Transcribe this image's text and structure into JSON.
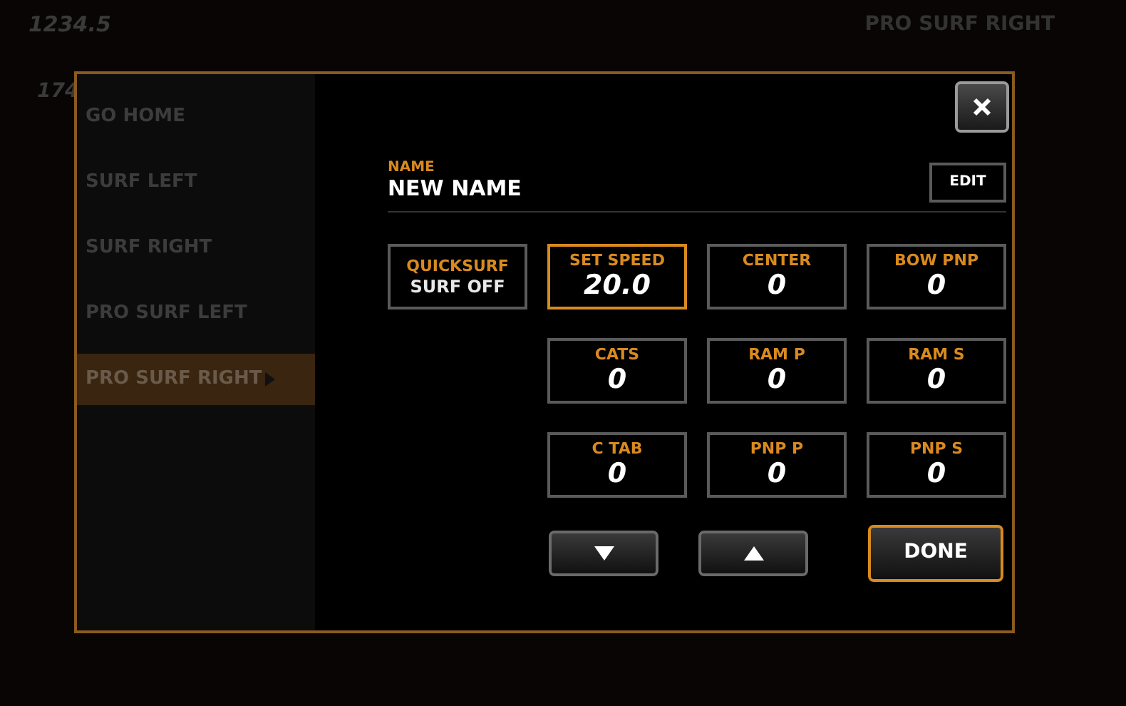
{
  "background": {
    "speed": "1234.5",
    "reading": "174",
    "mode": "PRO SURF RIGHT"
  },
  "sidebar": {
    "items": [
      {
        "label": "GO HOME",
        "selected": false
      },
      {
        "label": "SURF LEFT",
        "selected": false
      },
      {
        "label": "SURF RIGHT",
        "selected": false
      },
      {
        "label": "PRO SURF LEFT",
        "selected": false
      },
      {
        "label": "PRO SURF RIGHT",
        "selected": true
      }
    ]
  },
  "name": {
    "label": "NAME",
    "value": "NEW NAME",
    "button": "EDIT"
  },
  "tiles": [
    [
      {
        "kind": "toggle",
        "label": "QUICKSURF",
        "value": "SURF OFF",
        "selected": false
      },
      {
        "kind": "number",
        "label": "SET SPEED",
        "value": "20.0",
        "selected": true
      },
      {
        "kind": "number",
        "label": "CENTER",
        "value": "0",
        "selected": false
      },
      {
        "kind": "number",
        "label": "BOW PNP",
        "value": "0",
        "selected": false
      }
    ],
    [
      {
        "kind": "number",
        "label": "CATS",
        "value": "0",
        "selected": false
      },
      {
        "kind": "number",
        "label": "RAM P",
        "value": "0",
        "selected": false
      },
      {
        "kind": "number",
        "label": "RAM S",
        "value": "0",
        "selected": false
      }
    ],
    [
      {
        "kind": "number",
        "label": "C TAB",
        "value": "0",
        "selected": false
      },
      {
        "kind": "number",
        "label": "PNP P",
        "value": "0",
        "selected": false
      },
      {
        "kind": "number",
        "label": "PNP S",
        "value": "0",
        "selected": false
      }
    ]
  ],
  "done_button": "DONE"
}
